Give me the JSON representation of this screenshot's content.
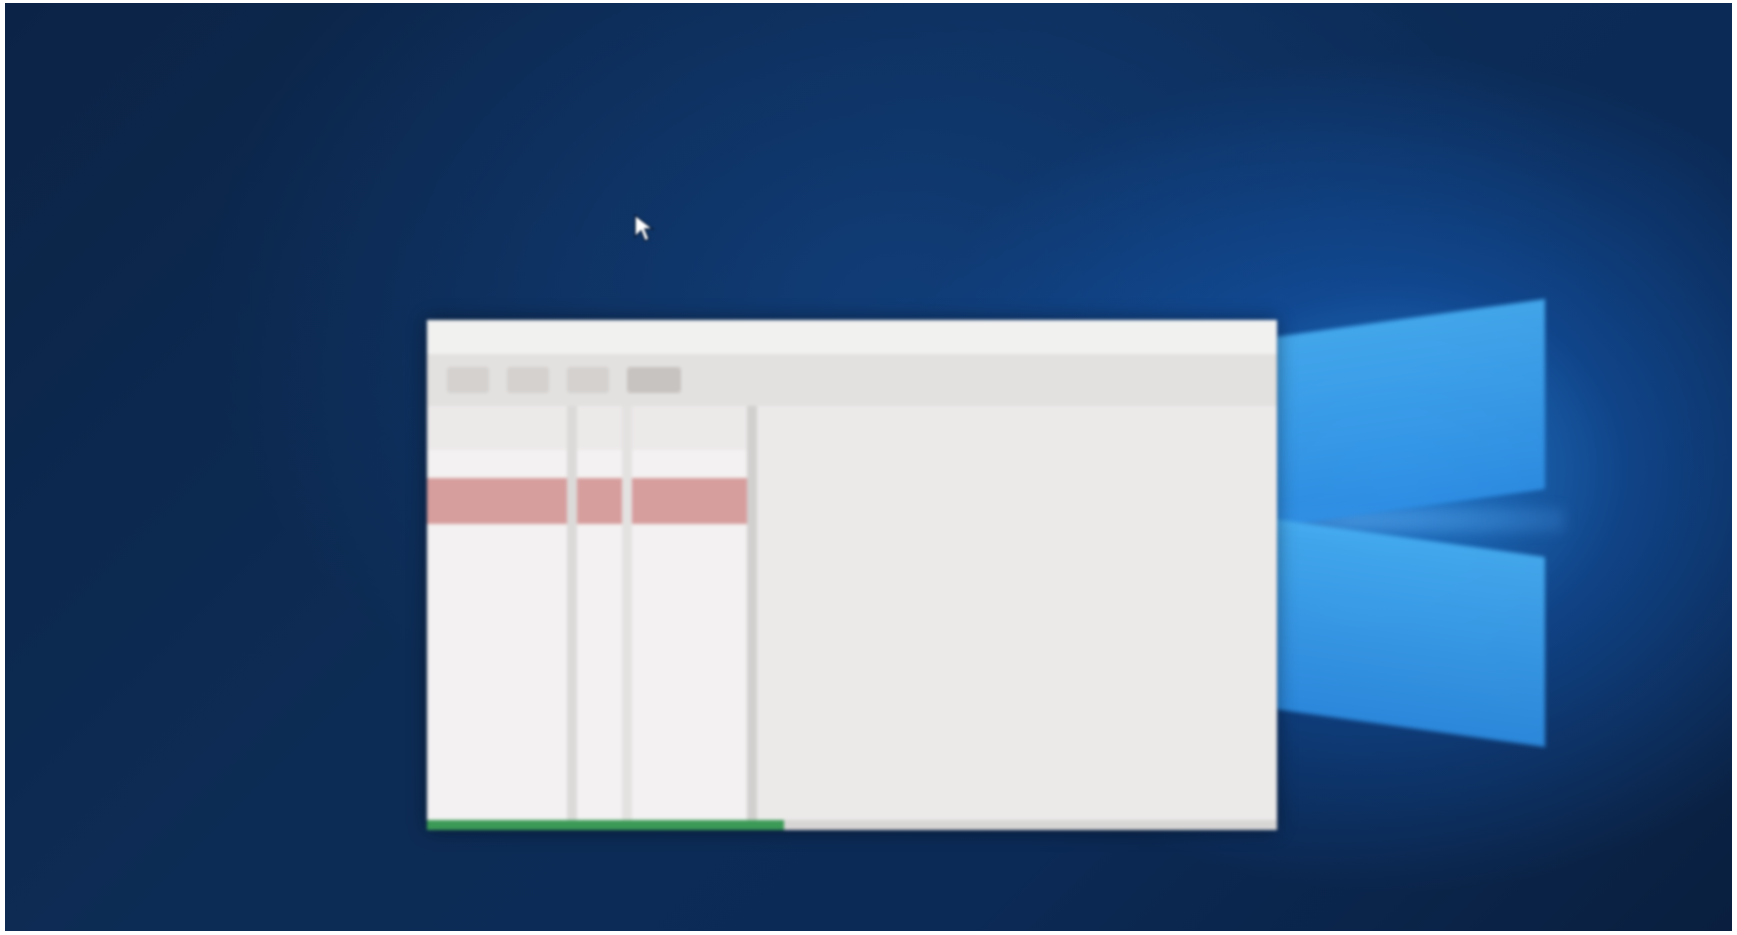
{
  "screen": {
    "wallpaper": "windows-10-default-hero",
    "accent": "#2f90e6",
    "background_dark": "#0b2346"
  },
  "window": {
    "title": "",
    "toolbar_icons": [
      "toolbar-icon",
      "toolbar-icon",
      "toolbar-icon",
      "toolbar-icon"
    ],
    "selected_row_color": "#d79e9e",
    "progress": {
      "fraction": 0.42,
      "color": "#3b9a56"
    }
  },
  "cursor": {
    "icon": "mouse-pointer-icon"
  }
}
